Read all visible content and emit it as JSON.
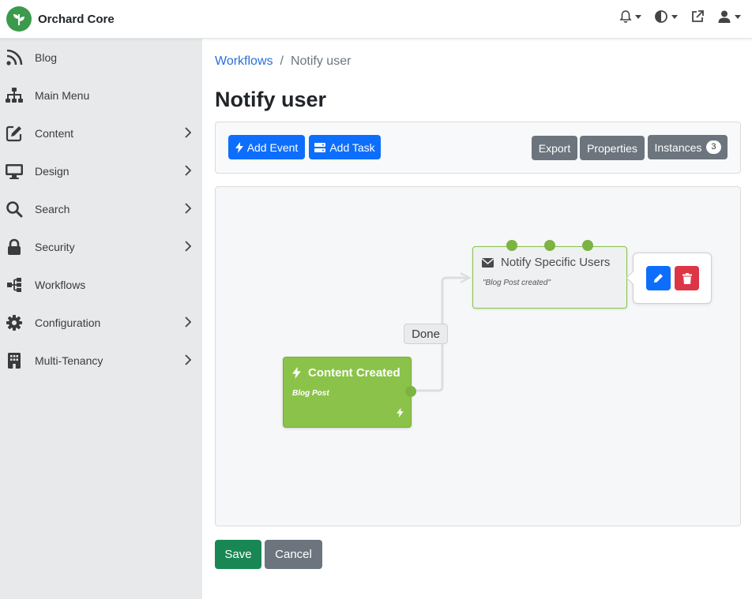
{
  "app": {
    "brand_name": "Orchard Core",
    "brand_color": "#3c9a4c"
  },
  "topbar": {
    "icons": [
      "bell-icon",
      "theme-contrast-icon",
      "external-link-icon",
      "user-icon"
    ]
  },
  "sidebar": {
    "items": [
      {
        "label": "Blog",
        "icon": "rss-icon",
        "has_children": false
      },
      {
        "label": "Main Menu",
        "icon": "sitemap-icon",
        "has_children": false
      },
      {
        "label": "Content",
        "icon": "edit-icon",
        "has_children": true
      },
      {
        "label": "Design",
        "icon": "desktop-icon",
        "has_children": true
      },
      {
        "label": "Search",
        "icon": "search-icon",
        "has_children": true
      },
      {
        "label": "Security",
        "icon": "lock-icon",
        "has_children": true
      },
      {
        "label": "Workflows",
        "icon": "workflow-icon",
        "has_children": false
      },
      {
        "label": "Configuration",
        "icon": "gear-icon",
        "has_children": true
      },
      {
        "label": "Multi-Tenancy",
        "icon": "building-icon",
        "has_children": true
      }
    ]
  },
  "breadcrumb": {
    "parent": "Workflows",
    "separator": "/",
    "current": "Notify user"
  },
  "page": {
    "title": "Notify user"
  },
  "toolbar": {
    "add_event": "Add Event",
    "add_task": "Add Task",
    "export": "Export",
    "properties": "Properties",
    "instances": "Instances",
    "instances_count": "3"
  },
  "canvas": {
    "event_node": {
      "title": "Content Created",
      "subtitle": "Blog Post",
      "color": "#8bc34a"
    },
    "task_node": {
      "title": "Notify Specific Users",
      "subtitle": "\"Blog Post created\""
    },
    "connection_label": "Done",
    "popover_actions": [
      "edit-icon",
      "trash-icon"
    ]
  },
  "footer": {
    "save": "Save",
    "cancel": "Cancel"
  },
  "colors": {
    "primary": "#0d6efd",
    "secondary": "#6c757d",
    "success": "#198754",
    "danger": "#dc3545",
    "endpoint": "#7cb342"
  }
}
